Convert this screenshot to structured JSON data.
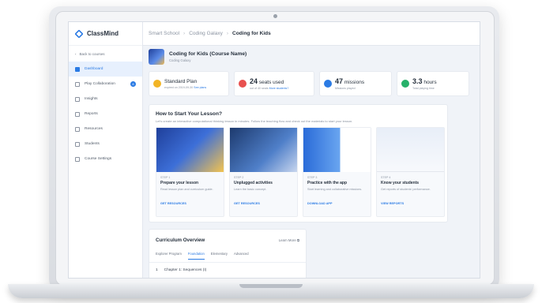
{
  "sidebar": {
    "app_name": "ClassMind",
    "back_label": "Back to courses",
    "items": [
      {
        "label": "Dashboard",
        "icon": "dashboard-icon"
      },
      {
        "label": "Play Collaboration",
        "icon": "play-icon",
        "badge": "8"
      },
      {
        "label": "Insights",
        "icon": "insights-icon"
      },
      {
        "label": "Reports",
        "icon": "reports-icon"
      },
      {
        "label": "Resources",
        "icon": "resources-icon"
      },
      {
        "label": "Students",
        "icon": "students-icon"
      },
      {
        "label": "Course Settings",
        "icon": "settings-icon"
      }
    ]
  },
  "breadcrumb": [
    "Smart School",
    "Coding Galaxy",
    "Coding for Kids"
  ],
  "course": {
    "name": "Coding for Kids (Course Name)",
    "subtitle": "Coding Galaxy"
  },
  "stats": [
    {
      "title": "Standard Plan",
      "sub": "expired on 2019-09-30",
      "link": "See plans",
      "color": "#f2b526"
    },
    {
      "value": "24",
      "unit": "seats used",
      "sub": "out of 40 seats",
      "link": "More students?",
      "color": "#e8504f"
    },
    {
      "value": "47",
      "unit": "missions",
      "sub": "Missions played",
      "color": "#2b7be4"
    },
    {
      "value": "3.3",
      "unit": "hours",
      "sub": "Total playing time",
      "color": "#27b16a"
    }
  ],
  "how": {
    "title": "How to Start Your Lesson?",
    "desc": "Let's create an interactive computational thinking lesson in minutes. Follow the teaching flow and check out the materials to start your lesson.",
    "steps": [
      {
        "num": "STEP 1",
        "title": "Prepare your lesson",
        "desc": "Read lesson plan and curriculum guide.",
        "link": "GET RESOURCES"
      },
      {
        "num": "STEP 2",
        "title": "Unplugged activities",
        "desc": "Learn the basic concept.",
        "link": "GET RESOURCES"
      },
      {
        "num": "STEP 3",
        "title": "Practice with the app",
        "desc": "Start learning and collaborative missions.",
        "link": "DOWNLOAD APP"
      },
      {
        "num": "STEP 4",
        "title": "Know your students",
        "desc": "Get reports of students' performance.",
        "link": "VIEW REPORTS"
      }
    ]
  },
  "curriculum": {
    "title": "Curriculum Overview",
    "learn_more": "Learn More",
    "tabs": [
      "Explorer Program",
      "Foundation",
      "Elementary",
      "Advanced"
    ],
    "active_tab": "Foundation",
    "chapter_num": "1",
    "chapter_title": "Chapter 1: Sequences (I)"
  }
}
